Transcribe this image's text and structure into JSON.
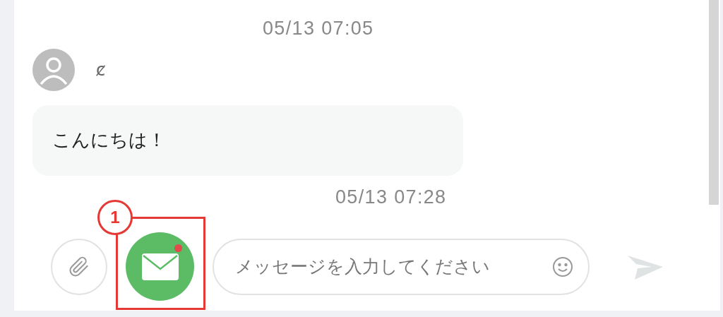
{
  "messages": [
    {
      "timestamp": "05/13 07:05",
      "sender": "ȼ",
      "text": "こんにちは！"
    }
  ],
  "last_timestamp": "05/13 07:28",
  "composer": {
    "placeholder": "メッセージを入力してください",
    "mail_unread": true
  },
  "annotation": {
    "label": "1"
  }
}
